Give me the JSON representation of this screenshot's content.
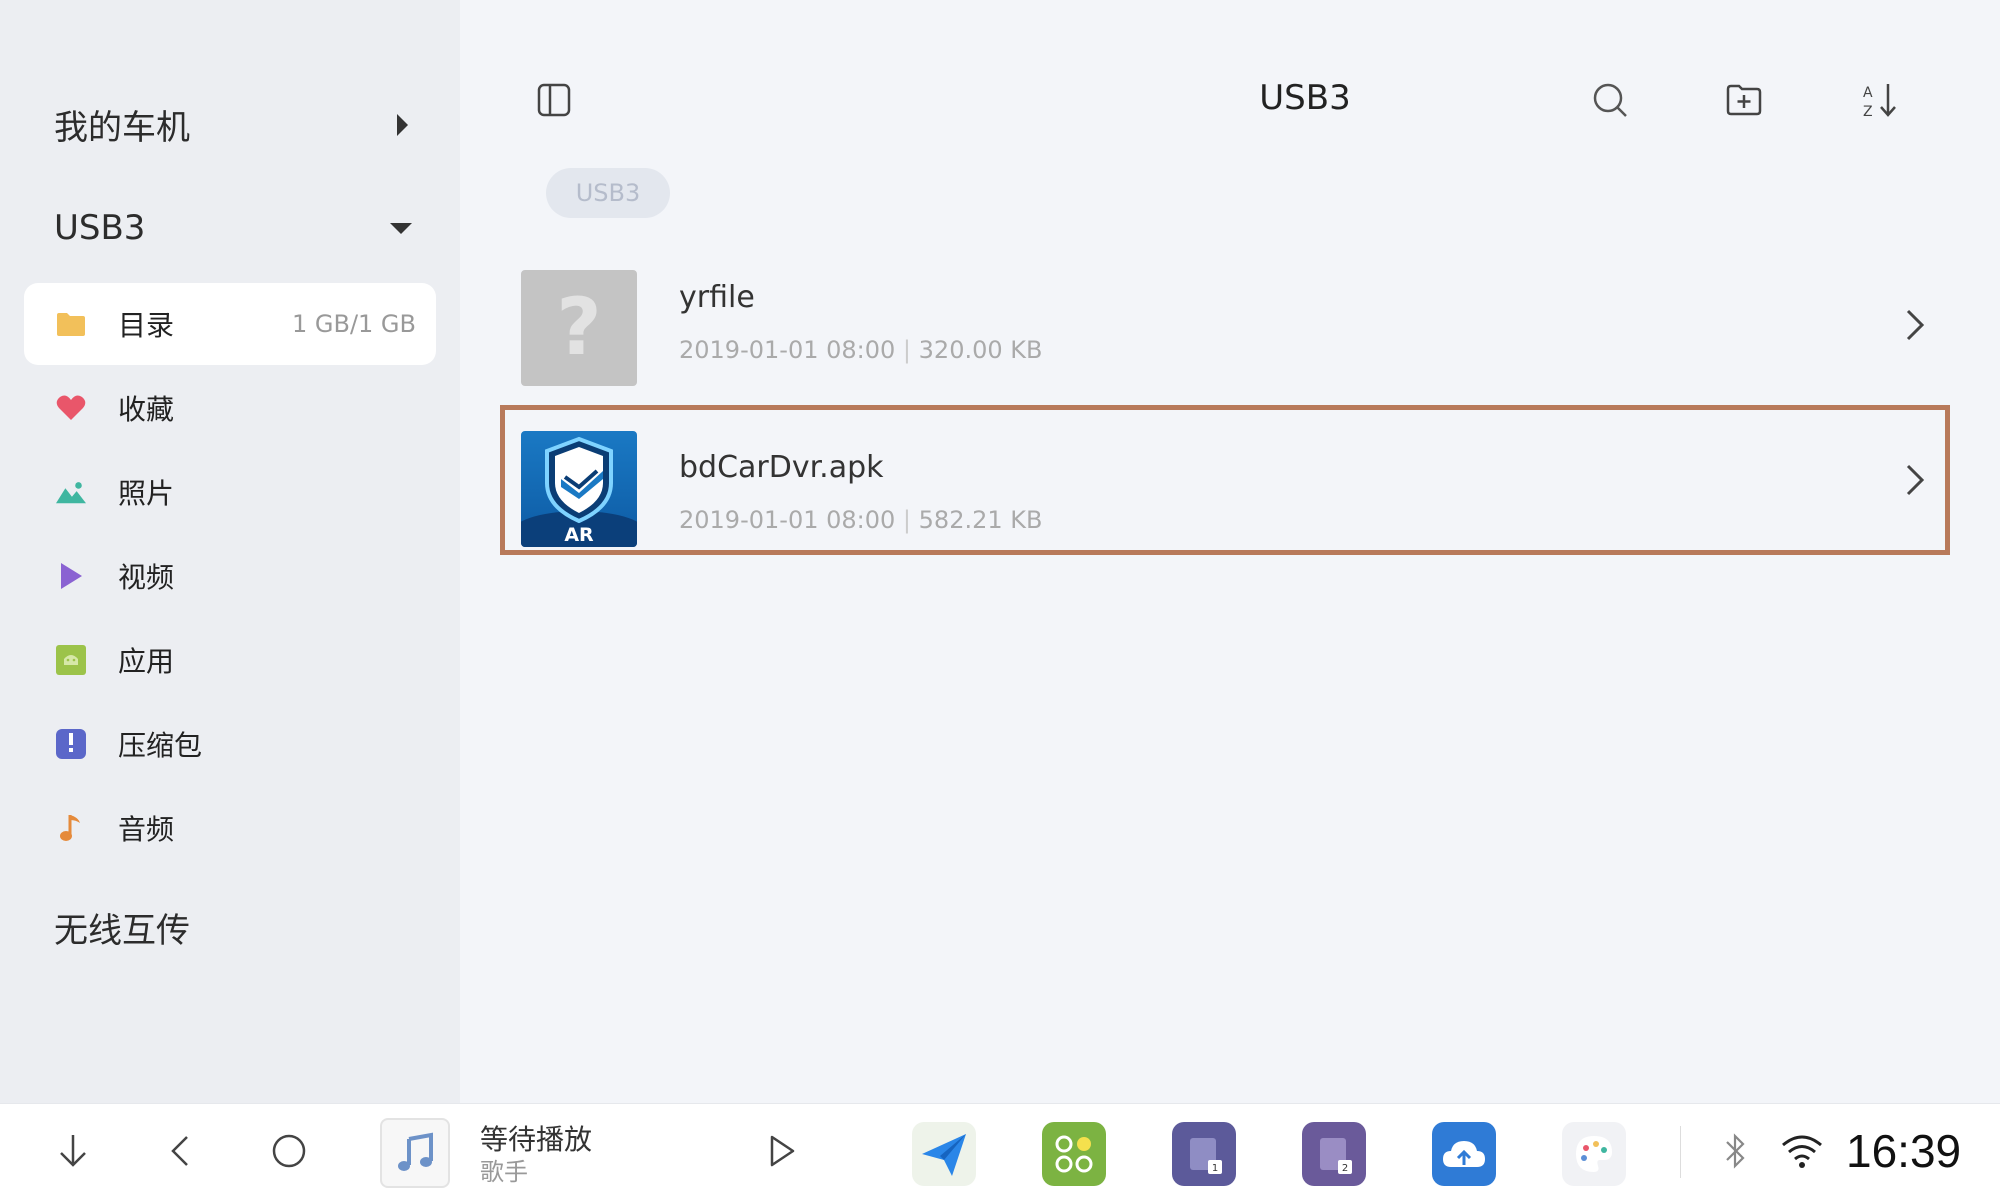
{
  "sidebar": {
    "heading_mycar": "我的车机",
    "heading_usb": "USB3",
    "heading_wireless": "无线互传",
    "items": [
      {
        "label": "目录",
        "caption": "1 GB/1 GB",
        "icon": "folder-icon",
        "color": "#f2c05a"
      },
      {
        "label": "收藏",
        "icon": "heart-icon",
        "color": "#e9566a"
      },
      {
        "label": "照片",
        "icon": "image-icon",
        "color": "#3fb6a0"
      },
      {
        "label": "视频",
        "icon": "play-icon",
        "color": "#8a62d2"
      },
      {
        "label": "应用",
        "icon": "android-icon",
        "color": "#9cc34a"
      },
      {
        "label": "压缩包",
        "icon": "archive-icon",
        "color": "#5b67c9"
      },
      {
        "label": "音频",
        "icon": "music-note-icon",
        "color": "#e58a3b"
      }
    ]
  },
  "main": {
    "title": "USB3",
    "breadcrumb": "USB3",
    "files": [
      {
        "name": "yrfile",
        "date": "2019-01-01 08:00",
        "size": "320.00 KB",
        "icon": "unknown-file-icon"
      },
      {
        "name": "bdCarDvr.apk",
        "date": "2019-01-01 08:00",
        "size": "582.21 KB",
        "icon": "ar-shield-app-icon",
        "thumb_label": "AR"
      }
    ]
  },
  "bottombar": {
    "music_title": "等待播放",
    "music_artist": "歌手",
    "clock": "16:39"
  },
  "colors": {
    "selection_border": "#b87a5b",
    "sidebar_bg": "#eceef2",
    "main_bg": "#f3f5f9"
  }
}
